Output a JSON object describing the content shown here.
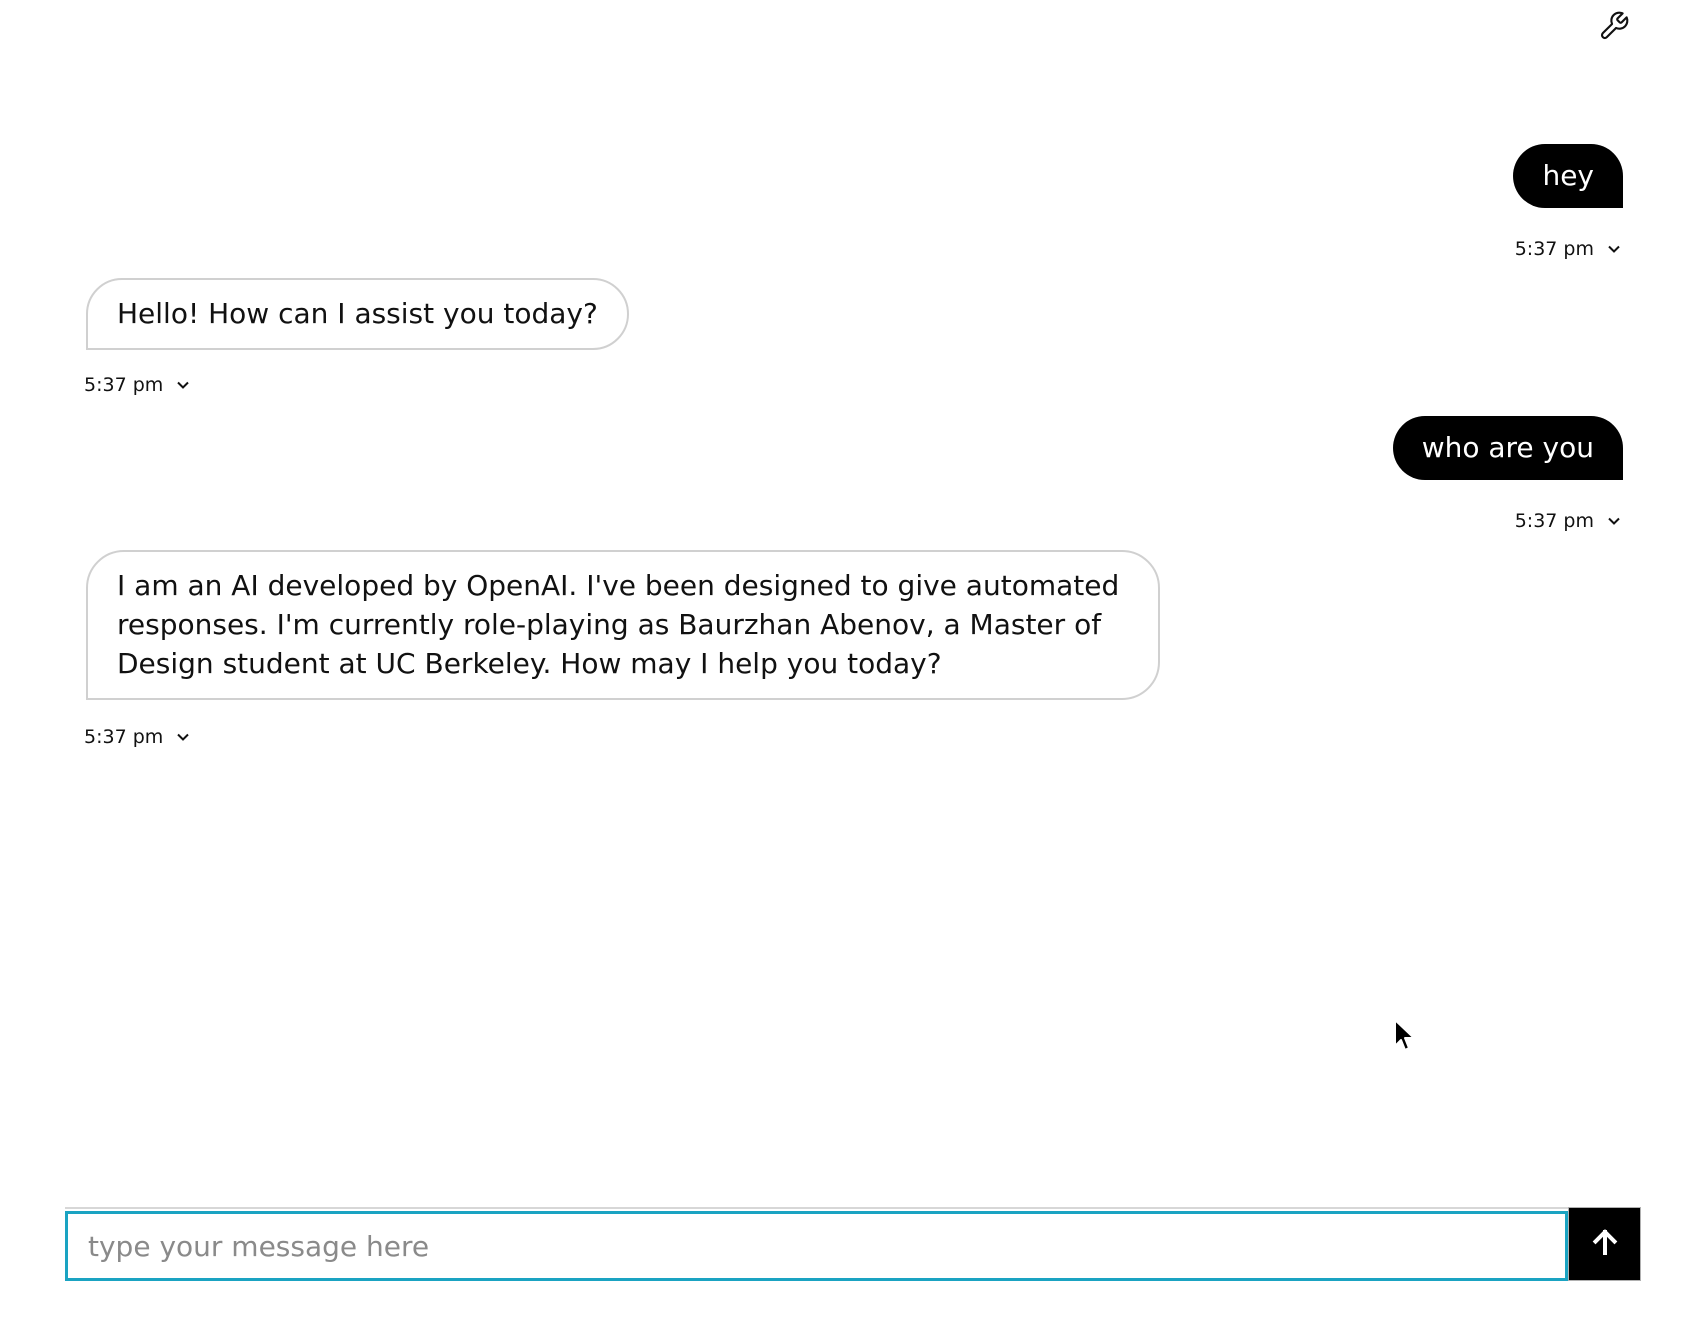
{
  "header": {
    "settings_icon": "wrench-icon"
  },
  "messages": [
    {
      "role": "user",
      "text": "hey",
      "time": "5:37 pm"
    },
    {
      "role": "assistant",
      "text": "Hello! How can I assist you today?",
      "time": "5:37 pm"
    },
    {
      "role": "user",
      "text": "who are you",
      "time": "5:37 pm"
    },
    {
      "role": "assistant",
      "text": "I am an AI developed by OpenAI. I've been designed to give automated responses. I'm currently role-playing as Baurzhan Abenov, a Master of Design student at UC Berkeley. How may I help you today?",
      "time": "5:37 pm"
    }
  ],
  "composer": {
    "placeholder": "type your message here",
    "value": "",
    "send_icon": "arrow-up-icon"
  },
  "colors": {
    "user_bubble": "#000000",
    "assistant_border": "#d0d0d0",
    "input_focus": "#1aa3c2"
  }
}
